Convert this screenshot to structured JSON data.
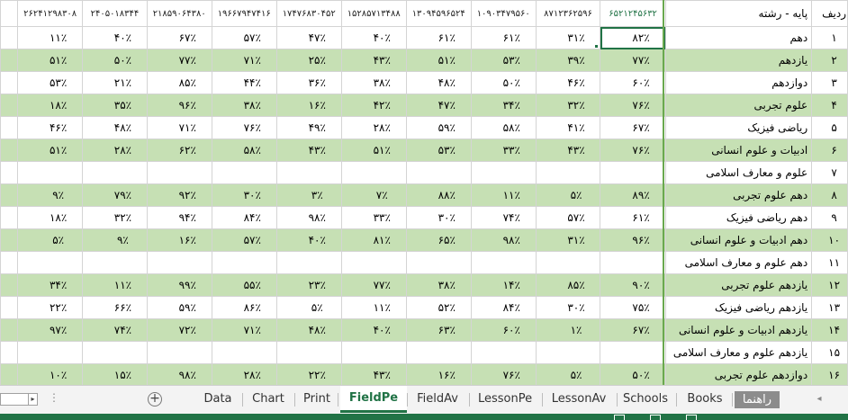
{
  "header": {
    "radif": "ردیف",
    "label": "پایه - رشته",
    "codes": [
      "۶۵۲۱۲۴۵۶۳۲",
      "۸۷۱۲۳۶۲۵۹۶",
      "۱۰۹۰۳۴۷۹۵۶۰",
      "۱۳۰۹۴۵۹۶۵۲۴",
      "۱۵۲۸۵۷۱۳۴۸۸",
      "۱۷۴۷۶۸۳۰۴۵۲",
      "۱۹۶۶۷۹۴۷۴۱۶",
      "۲۱۸۵۹۰۶۴۳۸۰",
      "۲۴۰۵۰۱۸۳۴۴",
      "۲۶۲۴۱۲۹۸۳۰۸",
      ""
    ]
  },
  "rows": [
    {
      "n": "۱",
      "label": "دهم",
      "vals": [
        "۸۲٪",
        "۳۱٪",
        "۶۱٪",
        "۶۱٪",
        "۴۰٪",
        "۴۷٪",
        "۵۷٪",
        "۶۷٪",
        "۴۰٪",
        "۱۱٪"
      ],
      "fill": "white"
    },
    {
      "n": "۲",
      "label": "یازدهم",
      "vals": [
        "۷۷٪",
        "۳۹٪",
        "۵۳٪",
        "۵۱٪",
        "۴۳٪",
        "۲۵٪",
        "۷۱٪",
        "۷۷٪",
        "۵۰٪",
        "۵۱٪"
      ],
      "fill": "green"
    },
    {
      "n": "۳",
      "label": "دوازدهم",
      "vals": [
        "۶۰٪",
        "۴۶٪",
        "۵۰٪",
        "۴۸٪",
        "۳۸٪",
        "۳۶٪",
        "۴۴٪",
        "۸۵٪",
        "۲۱٪",
        "۵۳٪"
      ],
      "fill": "white"
    },
    {
      "n": "۴",
      "label": "علوم تجربی",
      "vals": [
        "۷۶٪",
        "۳۲٪",
        "۳۴٪",
        "۴۷٪",
        "۴۲٪",
        "۱۶٪",
        "۳۸٪",
        "۹۶٪",
        "۳۵٪",
        "۱۸٪"
      ],
      "fill": "green"
    },
    {
      "n": "۵",
      "label": "ریاضی فیزیک",
      "vals": [
        "۶۷٪",
        "۴۱٪",
        "۵۸٪",
        "۵۹٪",
        "۲۸٪",
        "۴۹٪",
        "۷۶٪",
        "۷۱٪",
        "۴۸٪",
        "۴۶٪"
      ],
      "fill": "white"
    },
    {
      "n": "۶",
      "label": "ادبیات و علوم انسانی",
      "vals": [
        "۷۶٪",
        "۴۳٪",
        "۳۳٪",
        "۵۳٪",
        "۵۱٪",
        "۴۳٪",
        "۵۸٪",
        "۶۲٪",
        "۲۸٪",
        "۵۱٪"
      ],
      "fill": "green"
    },
    {
      "n": "۷",
      "label": "علوم و معارف اسلامی",
      "vals": [
        "",
        "",
        "",
        "",
        "",
        "",
        "",
        "",
        "",
        ""
      ],
      "fill": "white"
    },
    {
      "n": "۸",
      "label": "دهم علوم تجربی",
      "vals": [
        "۸۹٪",
        "۵٪",
        "۱۱٪",
        "۸۸٪",
        "۷٪",
        "۳٪",
        "۳۰٪",
        "۹۲٪",
        "۷۹٪",
        "۹٪"
      ],
      "fill": "green"
    },
    {
      "n": "۹",
      "label": "دهم ریاضی فیزیک",
      "vals": [
        "۶۱٪",
        "۵۷٪",
        "۷۴٪",
        "۳۰٪",
        "۳۳٪",
        "۹۸٪",
        "۸۴٪",
        "۹۴٪",
        "۳۲٪",
        "۱۸٪"
      ],
      "fill": "white"
    },
    {
      "n": "۱۰",
      "label": "دهم ادبیات و علوم انسانی",
      "vals": [
        "۹۶٪",
        "۳۱٪",
        "۹۸٪",
        "۶۵٪",
        "۸۱٪",
        "۴۰٪",
        "۵۷٪",
        "۱۶٪",
        "۹٪",
        "۵٪"
      ],
      "fill": "green"
    },
    {
      "n": "۱۱",
      "label": "دهم علوم و معارف اسلامی",
      "vals": [
        "",
        "",
        "",
        "",
        "",
        "",
        "",
        "",
        "",
        ""
      ],
      "fill": "white"
    },
    {
      "n": "۱۲",
      "label": "یازدهم علوم تجربی",
      "vals": [
        "۹۰٪",
        "۸۵٪",
        "۱۴٪",
        "۳۸٪",
        "۷۷٪",
        "۲۳٪",
        "۵۵٪",
        "۹۹٪",
        "۱۱٪",
        "۳۴٪"
      ],
      "fill": "green"
    },
    {
      "n": "۱۳",
      "label": "یازدهم ریاضی فیزیک",
      "vals": [
        "۷۵٪",
        "۳۰٪",
        "۸۴٪",
        "۵۲٪",
        "۱۱٪",
        "۵٪",
        "۸۶٪",
        "۵۹٪",
        "۶۶٪",
        "۲۲٪"
      ],
      "fill": "white"
    },
    {
      "n": "۱۴",
      "label": "یازدهم ادبیات و علوم انسانی",
      "vals": [
        "۶۷٪",
        "۱٪",
        "۶۰٪",
        "۶۳٪",
        "۴۰٪",
        "۴۸٪",
        "۷۱٪",
        "۷۲٪",
        "۷۴٪",
        "۹۷٪"
      ],
      "fill": "green"
    },
    {
      "n": "۱۵",
      "label": "یازدهم علوم و معارف اسلامی",
      "vals": [
        "",
        "",
        "",
        "",
        "",
        "",
        "",
        "",
        "",
        ""
      ],
      "fill": "white"
    },
    {
      "n": "۱۶",
      "label": "دوازدهم علوم تجربی",
      "vals": [
        "۵۰٪",
        "۵٪",
        "۷۶٪",
        "۱۶٪",
        "۴۳٪",
        "۲۲٪",
        "۲۸٪",
        "۹۸٪",
        "۱۵٪",
        "۱۰٪"
      ],
      "fill": "green"
    }
  ],
  "tabs": [
    {
      "label": "راهنما",
      "state": "special"
    },
    {
      "label": "Books",
      "state": "normal"
    },
    {
      "label": "Schools",
      "state": "normal"
    },
    {
      "label": "LessonAv",
      "state": "normal"
    },
    {
      "label": "LessonPe",
      "state": "normal"
    },
    {
      "label": "FieldAv",
      "state": "normal"
    },
    {
      "label": "FieldPe",
      "state": "active"
    },
    {
      "label": "Print",
      "state": "normal"
    },
    {
      "label": "Chart",
      "state": "normal"
    },
    {
      "label": "Data",
      "state": "normal"
    }
  ],
  "sheetbar": {
    "add_symbol": "+",
    "more_symbol": "⋮",
    "scroll_symbol": "▸",
    "nav_symbol": "◂"
  },
  "colors": {
    "accent": "#217346",
    "row_fill": "#c6e0b4"
  }
}
